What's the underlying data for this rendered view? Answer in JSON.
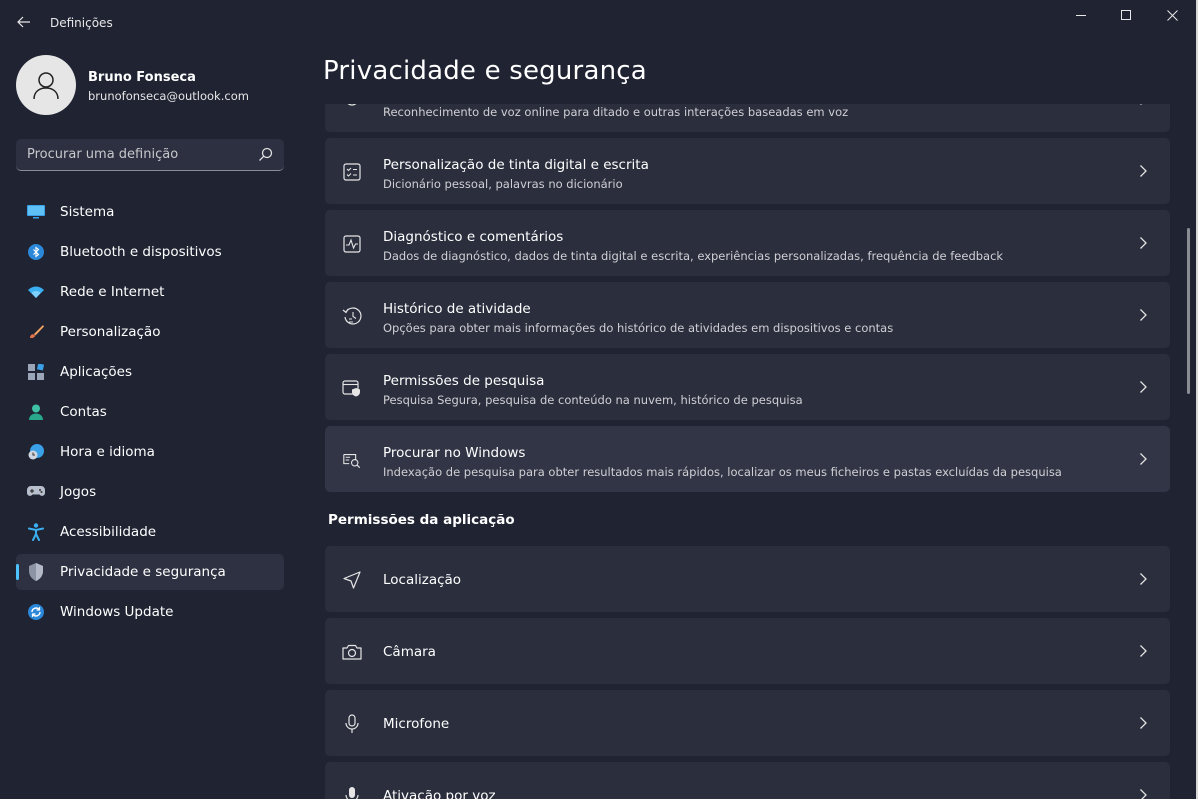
{
  "window": {
    "title": "Definições"
  },
  "profile": {
    "name": "Bruno Fonseca",
    "email": "brunofonseca@outlook.com"
  },
  "search": {
    "placeholder": "Procurar uma definição"
  },
  "sidebar": {
    "items": [
      {
        "label": "Sistema",
        "icon": "monitor-icon"
      },
      {
        "label": "Bluetooth e dispositivos",
        "icon": "bluetooth-icon"
      },
      {
        "label": "Rede e Internet",
        "icon": "wifi-icon"
      },
      {
        "label": "Personalização",
        "icon": "brush-icon"
      },
      {
        "label": "Aplicações",
        "icon": "apps-icon"
      },
      {
        "label": "Contas",
        "icon": "account-icon"
      },
      {
        "label": "Hora e idioma",
        "icon": "clock-globe-icon"
      },
      {
        "label": "Jogos",
        "icon": "gamepad-icon"
      },
      {
        "label": "Acessibilidade",
        "icon": "accessibility-icon"
      },
      {
        "label": "Privacidade e segurança",
        "icon": "shield-icon",
        "active": true
      },
      {
        "label": "Windows Update",
        "icon": "update-icon"
      }
    ]
  },
  "main": {
    "title": "Privacidade e segurança",
    "cards": [
      {
        "title": "",
        "desc": "Reconhecimento de voz online para ditado e outras interações baseadas em voz",
        "icon": "speech-icon"
      },
      {
        "title": "Personalização de tinta digital e escrita",
        "desc": "Dicionário pessoal, palavras no dicionário",
        "icon": "inking-icon"
      },
      {
        "title": "Diagnóstico e comentários",
        "desc": "Dados de diagnóstico, dados de tinta digital e escrita, experiências personalizadas, frequência de feedback",
        "icon": "diagnostics-icon"
      },
      {
        "title": "Histórico de atividade",
        "desc": "Opções para obter mais informações do histórico de atividades em dispositivos e contas",
        "icon": "history-icon"
      },
      {
        "title": "Permissões de pesquisa",
        "desc": "Pesquisa Segura, pesquisa de conteúdo na nuvem, histórico de pesquisa",
        "icon": "search-permissions-icon"
      },
      {
        "title": "Procurar no Windows",
        "desc": "Indexação de pesquisa para obter resultados mais rápidos, localizar os meus ficheiros e pastas excluídas da pesquisa",
        "icon": "windows-search-icon"
      }
    ],
    "section_label": "Permissões da aplicação",
    "app_permissions": [
      {
        "title": "Localização",
        "icon": "location-icon"
      },
      {
        "title": "Câmara",
        "icon": "camera-icon"
      },
      {
        "title": "Microfone",
        "icon": "microphone-icon"
      },
      {
        "title": "Ativação por voz",
        "icon": "voice-activation-icon"
      }
    ]
  },
  "colors": {
    "accent": "#4cc2ff",
    "background": "#1f2332",
    "card": "#2a2e3d"
  }
}
